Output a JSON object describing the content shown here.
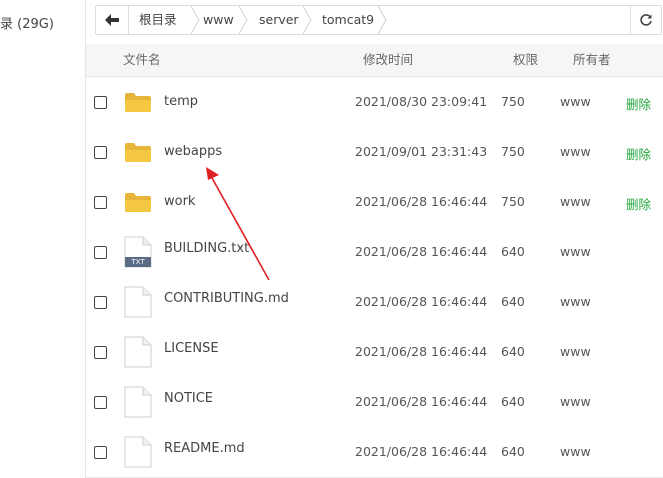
{
  "sidebar": {
    "disk_label": "录 (29G)"
  },
  "breadcrumb": {
    "items": [
      "根目录",
      "www",
      "server",
      "tomcat9"
    ]
  },
  "table": {
    "headers": {
      "name": "文件名",
      "modified": "修改时间",
      "permission": "权限",
      "owner": "所有者"
    },
    "rows": [
      {
        "type": "folder",
        "name": "temp",
        "modified": "2021/08/30 23:09:41",
        "permission": "750",
        "owner": "www",
        "action": "删除"
      },
      {
        "type": "folder",
        "name": "webapps",
        "modified": "2021/09/01 23:31:43",
        "permission": "750",
        "owner": "www",
        "action": "删除"
      },
      {
        "type": "folder",
        "name": "work",
        "modified": "2021/06/28 16:46:44",
        "permission": "750",
        "owner": "www",
        "action": "删除"
      },
      {
        "type": "txt",
        "icon_label": "TXT",
        "name": "BUILDING.txt",
        "modified": "2021/06/28 16:46:44",
        "permission": "640",
        "owner": "www",
        "action": ""
      },
      {
        "type": "file",
        "name": "CONTRIBUTING.md",
        "modified": "2021/06/28 16:46:44",
        "permission": "640",
        "owner": "www",
        "action": ""
      },
      {
        "type": "file",
        "name": "LICENSE",
        "modified": "2021/06/28 16:46:44",
        "permission": "640",
        "owner": "www",
        "action": ""
      },
      {
        "type": "file",
        "name": "NOTICE",
        "modified": "2021/06/28 16:46:44",
        "permission": "640",
        "owner": "www",
        "action": ""
      },
      {
        "type": "file",
        "name": "README.md",
        "modified": "2021/06/28 16:46:44",
        "permission": "640",
        "owner": "www",
        "action": ""
      }
    ]
  },
  "colors": {
    "delete_link": "#20a53a",
    "folder": "#f5c842",
    "annotation_arrow": "#e02020"
  },
  "icons": {
    "back": "arrow-left-icon",
    "refresh": "refresh-icon",
    "folder": "folder-icon",
    "file": "file-icon",
    "txt": "txt-file-icon"
  }
}
